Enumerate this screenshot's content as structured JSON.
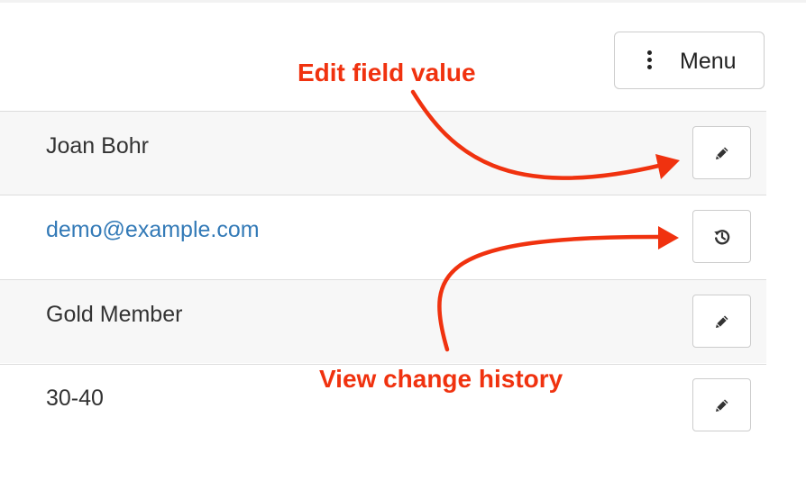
{
  "menu": {
    "label": "Menu",
    "icon": "vertical-dots-icon"
  },
  "rows": [
    {
      "value": "Joan Bohr",
      "is_link": false,
      "action_icon": "pencil-icon",
      "action": "edit"
    },
    {
      "value": "demo@example.com",
      "is_link": true,
      "action_icon": "history-icon",
      "action": "history"
    },
    {
      "value": "Gold Member",
      "is_link": false,
      "action_icon": "pencil-icon",
      "action": "edit"
    },
    {
      "value": "30-40",
      "is_link": false,
      "action_icon": "pencil-icon",
      "action": "edit"
    }
  ],
  "annotations": {
    "edit": "Edit field value",
    "history": "View change history"
  },
  "colors": {
    "annotation": "#f0320f",
    "link": "#337ab7",
    "stripe": "#f7f7f7",
    "border": "#dddddd",
    "button_border": "#cccccc",
    "text": "#333333"
  }
}
